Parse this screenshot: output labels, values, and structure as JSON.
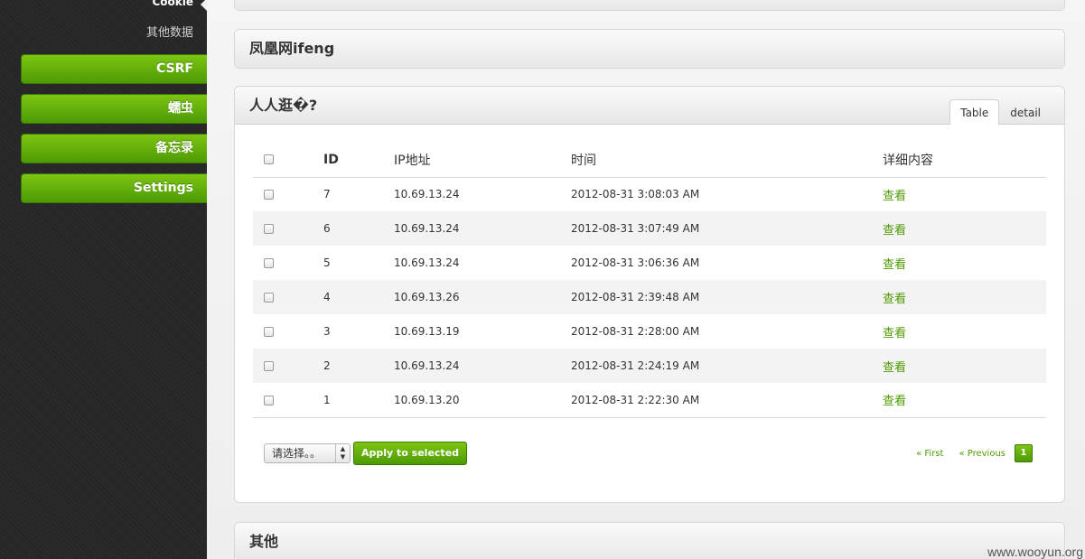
{
  "sidebar": {
    "cookie_label": "Cookie",
    "other_label": "其他数据",
    "buttons": [
      "CSRF",
      "蠕虫",
      "备忘录",
      "Settings"
    ]
  },
  "top_box": {},
  "ifeng_box": {
    "title": "凤凰网ifeng"
  },
  "renren_box": {
    "title": "人人逛�?",
    "tabs": [
      "Table",
      "detail"
    ],
    "columns": [
      "ID",
      "IP地址",
      "时间",
      "详细内容"
    ],
    "rows": [
      {
        "id": "7",
        "ip": "10.69.13.24",
        "time": "2012-08-31 3:08:03 AM",
        "link": "查看"
      },
      {
        "id": "6",
        "ip": "10.69.13.24",
        "time": "2012-08-31 3:07:49 AM",
        "link": "查看"
      },
      {
        "id": "5",
        "ip": "10.69.13.24",
        "time": "2012-08-31 3:06:36 AM",
        "link": "查看"
      },
      {
        "id": "4",
        "ip": "10.69.13.26",
        "time": "2012-08-31 2:39:48 AM",
        "link": "查看"
      },
      {
        "id": "3",
        "ip": "10.69.13.19",
        "time": "2012-08-31 2:28:00 AM",
        "link": "查看"
      },
      {
        "id": "2",
        "ip": "10.69.13.24",
        "time": "2012-08-31 2:24:19 AM",
        "link": "查看"
      },
      {
        "id": "1",
        "ip": "10.69.13.20",
        "time": "2012-08-31 2:22:30 AM",
        "link": "查看"
      }
    ],
    "select_value": "请选择。。",
    "apply_label": "Apply to selected",
    "pager": {
      "first": "« First",
      "previous": "« Previous",
      "current": "1"
    }
  },
  "other_box": {
    "title": "其他"
  },
  "watermark": "www.wooyun.org",
  "colors": {
    "accent": "#5aa80a",
    "sidebar_bg": "#262626"
  }
}
